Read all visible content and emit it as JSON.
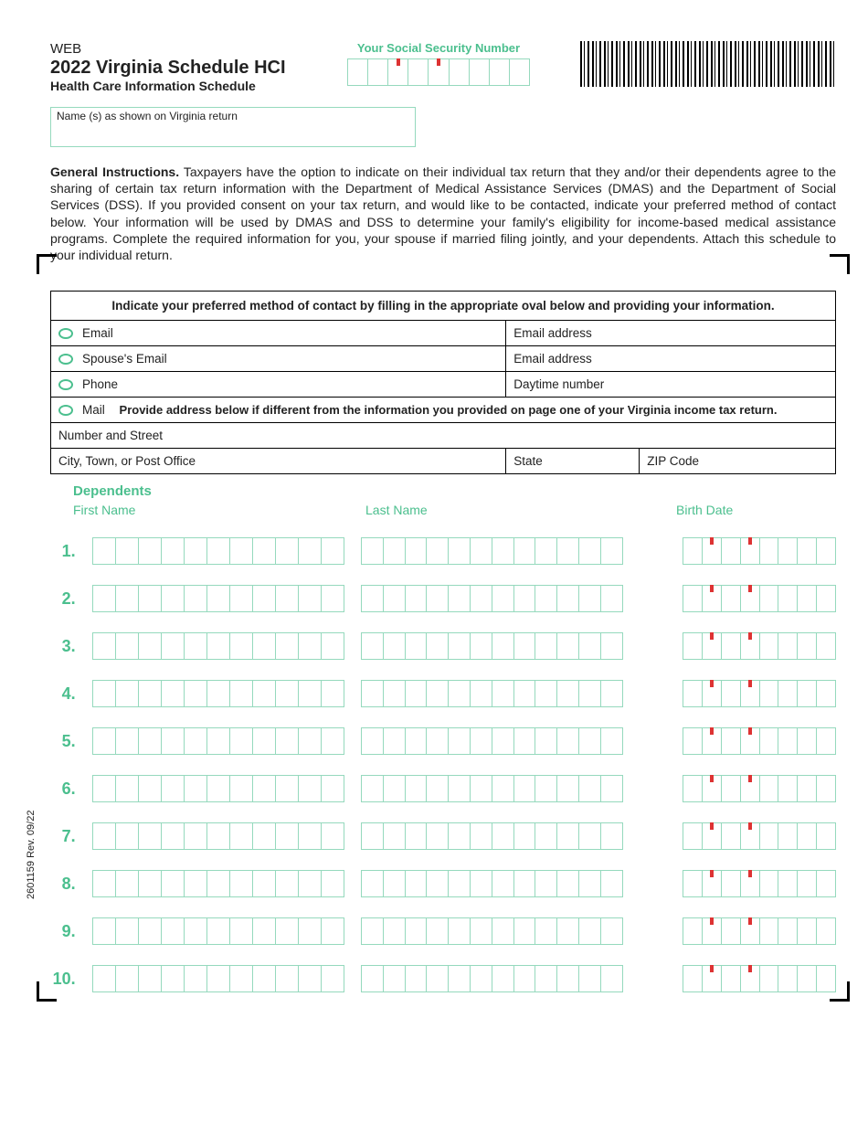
{
  "header": {
    "web": "WEB",
    "title": "2022 Virginia Schedule HCI",
    "subtitle": "Health Care Information Schedule",
    "ssn_label": "Your Social Security Number",
    "name_label": "Name (s) as shown on Virginia return"
  },
  "instructions": {
    "lead": "General Instructions.",
    "body": "Taxpayers have the option to indicate on their individual tax return that they and/or their dependents agree to the sharing of certain tax return information with the Department of Medical Assistance Services (DMAS) and the Department of Social Services (DSS). If you provided consent on your tax return, and would like to be contacted, indicate your preferred method of contact below. Your information will be used by DMAS and DSS to determine your family's eligibility for income-based medical assistance programs. Complete the required information for you, your spouse if married filing jointly, and your dependents. Attach this schedule to your individual return."
  },
  "contact": {
    "heading": "Indicate your preferred method of contact by filling in the appropriate oval below and providing your information.",
    "email_label": "Email",
    "email_field": "Email address",
    "spouse_email_label": "Spouse's Email",
    "spouse_email_field": "Email address",
    "phone_label": "Phone",
    "phone_field": "Daytime number",
    "mail_label": "Mail",
    "mail_note": "Provide address below if different from the information you provided on page one of your Virginia income tax return.",
    "street_label": "Number and Street",
    "city_label": "City, Town, or Post Office",
    "state_label": "State",
    "zip_label": "ZIP Code"
  },
  "dependents": {
    "heading": "Dependents",
    "col_first": "First Name",
    "col_last": "Last Name",
    "col_birth": "Birth Date",
    "rows": [
      "1.",
      "2.",
      "3.",
      "4.",
      "5.",
      "6.",
      "7.",
      "8.",
      "9.",
      "10."
    ]
  },
  "footer": {
    "rev": "2601159 Rev. 09/22"
  }
}
